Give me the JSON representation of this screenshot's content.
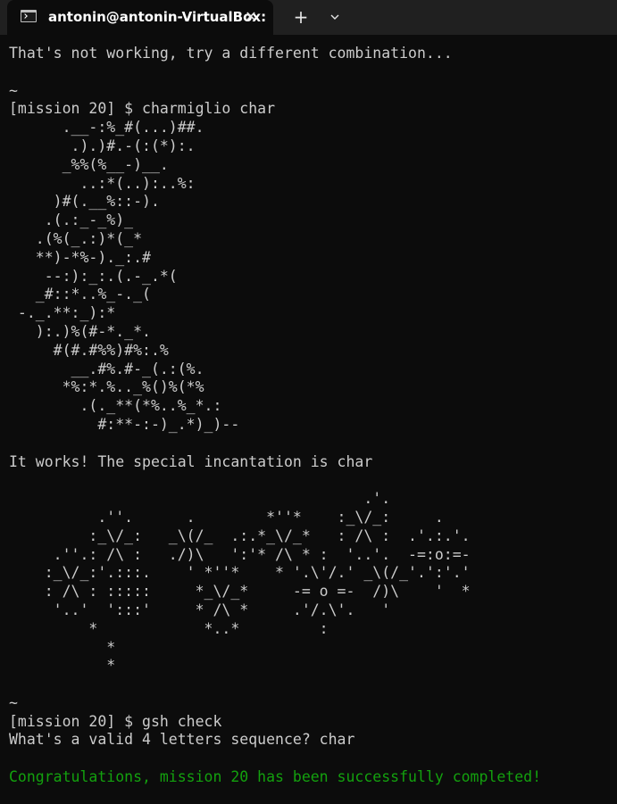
{
  "tab": {
    "title": "antonin@antonin-VirtualBox:",
    "icon": "terminal-icon",
    "close_icon": "close-icon"
  },
  "new_tab_icon": "plus-icon",
  "dropdown_icon": "chevron-down-icon",
  "colors": {
    "background": "#0c0c0c",
    "tabbar": "#202020",
    "text": "#cccccc",
    "success": "#13a10e"
  },
  "terminal": {
    "lines": [
      {
        "text": "That's not working, try a different combination...",
        "style": "normal"
      },
      {
        "text": "",
        "style": "normal"
      },
      {
        "text": "~",
        "style": "normal"
      },
      {
        "text": "[mission 20] $ charmiglio char",
        "style": "normal"
      },
      {
        "text": "      .__-:%_#(...)##.",
        "style": "normal"
      },
      {
        "text": "       .).)#.-(:(*):.",
        "style": "normal"
      },
      {
        "text": "      _%%(%__-)__.",
        "style": "normal"
      },
      {
        "text": "        ..:*(..):..%:",
        "style": "normal"
      },
      {
        "text": "     )#(.__%::-).",
        "style": "normal"
      },
      {
        "text": "    .(.:_-_%)_",
        "style": "normal"
      },
      {
        "text": "   .(%(_.:)*(_*",
        "style": "normal"
      },
      {
        "text": "   **)-*%-)._:.#",
        "style": "normal"
      },
      {
        "text": "    --:):_:.(.-_.*(",
        "style": "normal"
      },
      {
        "text": "   _#::*..%_-._(",
        "style": "normal"
      },
      {
        "text": " -._.**:_):*",
        "style": "normal"
      },
      {
        "text": "   ):.)%(#-*._*.",
        "style": "normal"
      },
      {
        "text": "     #(#.#%%)#%:.%",
        "style": "normal"
      },
      {
        "text": "       __.#%.#-_(.:(%.",
        "style": "normal"
      },
      {
        "text": "      *%:*.%.._%()%(*%",
        "style": "normal"
      },
      {
        "text": "        .(._**(*%..%_*.:",
        "style": "normal"
      },
      {
        "text": "          #:**-:-)_.*)_)--",
        "style": "normal"
      },
      {
        "text": "",
        "style": "normal"
      },
      {
        "text": "It works! The special incantation is char",
        "style": "normal"
      },
      {
        "text": "",
        "style": "normal"
      },
      {
        "text": "                                        .'.",
        "style": "normal"
      },
      {
        "text": "          .''.      .        *''*    :_\\/_:     .",
        "style": "normal"
      },
      {
        "text": "         :_\\/_:   _\\(/_  .:.*_\\/_*   : /\\ :  .'.:.'.",
        "style": "normal"
      },
      {
        "text": "     .''.: /\\ :   ./)\\   ':'* /\\ * :  '..'.  -=:o:=-",
        "style": "normal"
      },
      {
        "text": "    :_\\/_:'.:::.    ' *''*    * '.\\'/.' _\\(/_'.':'.'",
        "style": "normal"
      },
      {
        "text": "    : /\\ : :::::     *_\\/_*     -= o =-  /)\\    '  *",
        "style": "normal"
      },
      {
        "text": "     '..'  ':::'     * /\\ *     .'/.\\'.   '",
        "style": "normal"
      },
      {
        "text": "         *            *..*         :",
        "style": "normal"
      },
      {
        "text": "           *",
        "style": "normal"
      },
      {
        "text": "           *",
        "style": "normal"
      },
      {
        "text": "",
        "style": "normal"
      },
      {
        "text": "~",
        "style": "normal"
      },
      {
        "text": "[mission 20] $ gsh check",
        "style": "normal"
      },
      {
        "text": "What's a valid 4 letters sequence? char",
        "style": "normal"
      },
      {
        "text": "",
        "style": "normal"
      },
      {
        "text": "Congratulations, mission 20 has been successfully completed!",
        "style": "success"
      }
    ]
  }
}
